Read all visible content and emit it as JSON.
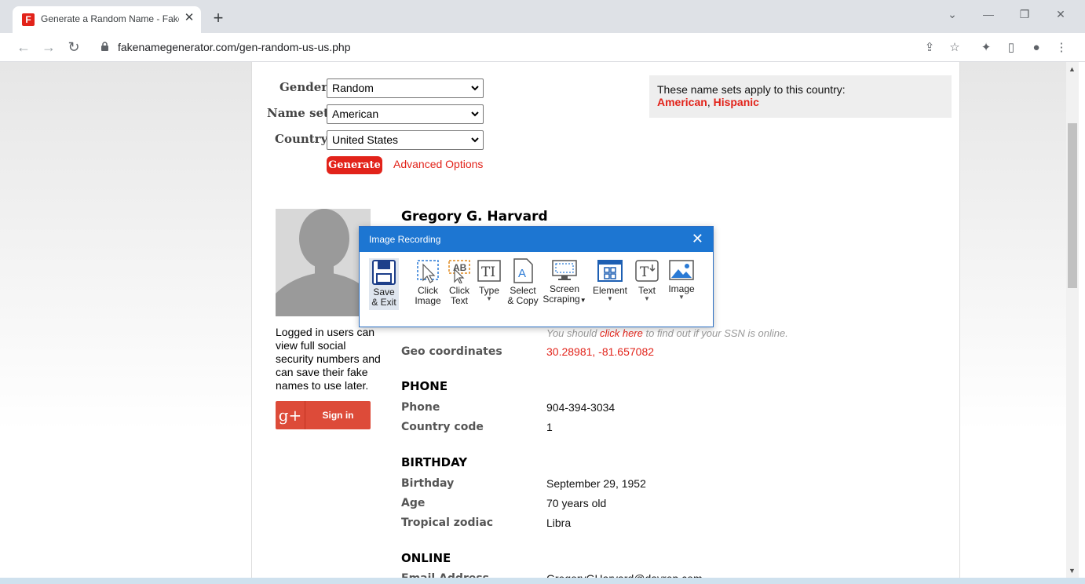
{
  "browser": {
    "tab_title": "Generate a Random Name - Fake Name Generator",
    "favicon_letter": "F",
    "close_tab": "✕",
    "new_tab": "+",
    "url": "fakenamegenerator.com/gen-random-us-us.php"
  },
  "form": {
    "gender_label": "Gender",
    "gender_value": "Random",
    "nameset_label": "Name set",
    "nameset_value": "American",
    "country_label": "Country",
    "country_value": "United States",
    "generate_label": "Generate",
    "advanced_label": "Advanced Options"
  },
  "namesets_box": {
    "intro": "These name sets apply to this country:",
    "set1": "American",
    "separator": ", ",
    "set2": "Hispanic"
  },
  "sidebar": {
    "login_note": "Logged in users can view full social security numbers and can save their fake names to use later.",
    "gplus_icon": "g+",
    "signin_label": "Sign in"
  },
  "identity": {
    "name": "Gregory G. Harvard",
    "ssn_note_pre": "You should ",
    "ssn_note_link": "click here",
    "ssn_note_post": " to find out if your SSN is online.",
    "geo_label": "Geo coordinates",
    "geo_value": "30.28981, -81.657082"
  },
  "phone": {
    "heading": "PHONE",
    "phone_label": "Phone",
    "phone_value": "904-394-3034",
    "cc_label": "Country code",
    "cc_value": "1"
  },
  "birthday": {
    "heading": "BIRTHDAY",
    "birthday_label": "Birthday",
    "birthday_value": "September 29, 1952",
    "age_label": "Age",
    "age_value": "70 years old",
    "zodiac_label": "Tropical zodiac",
    "zodiac_value": "Libra"
  },
  "online": {
    "heading": "ONLINE",
    "email_label": "Email Address",
    "email_value": "GregoryGHarvard@dayrep.com"
  },
  "dialog": {
    "title": "Image Recording",
    "close": "✕",
    "tools": [
      {
        "line1": "Save",
        "line2": "& Exit"
      },
      {
        "line1": "Click",
        "line2": "Image"
      },
      {
        "line1": "Click",
        "line2": "Text"
      },
      {
        "line1": "Type",
        "line2": ""
      },
      {
        "line1": "Select",
        "line2": "& Copy"
      },
      {
        "line1": "Screen",
        "line2": "Scraping"
      },
      {
        "line1": "Element",
        "line2": ""
      },
      {
        "line1": "Text",
        "line2": ""
      },
      {
        "line1": "Image",
        "line2": ""
      }
    ]
  },
  "colors": {
    "brand_red": "#e2231a",
    "dialog_blue": "#1d76d2",
    "google_red": "#dd4b39"
  }
}
